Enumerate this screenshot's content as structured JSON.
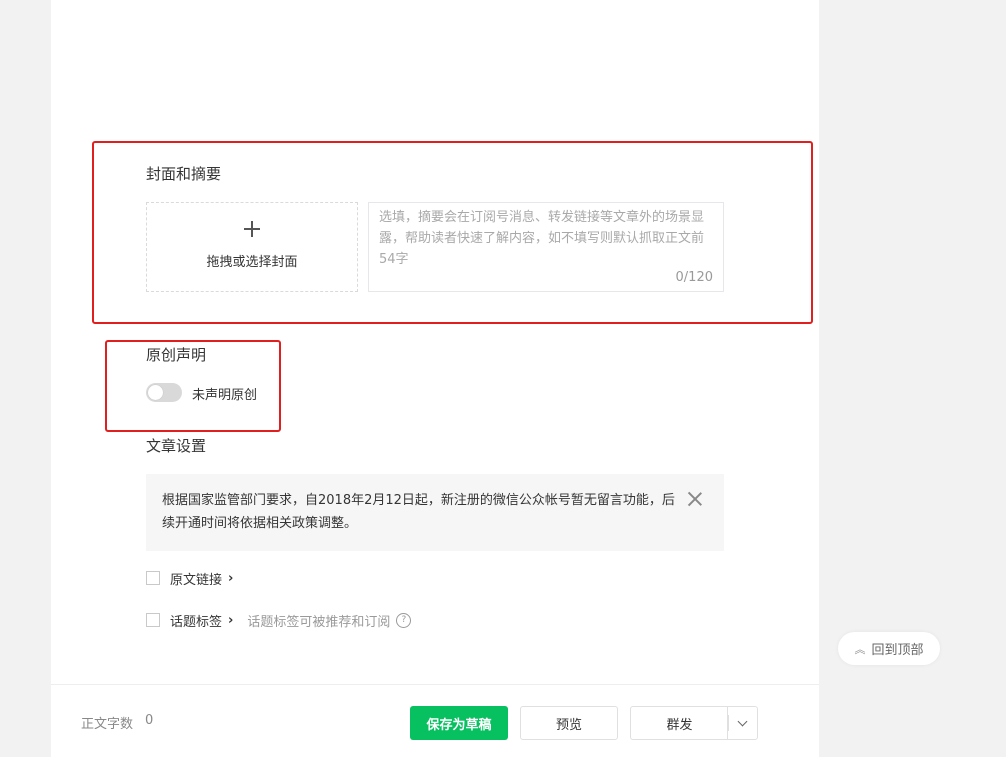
{
  "cover_summary": {
    "title": "封面和摘要",
    "cover_upload_label": "拖拽或选择封面",
    "summary_placeholder": "选填，摘要会在订阅号消息、转发链接等文章外的场景显露，帮助读者快速了解内容，如不填写则默认抓取正文前54字",
    "summary_counter": "0/120"
  },
  "original": {
    "title": "原创声明",
    "toggle_label": "未声明原创",
    "toggle_on": false
  },
  "article_settings": {
    "title": "文章设置",
    "notice": "根据国家监管部门要求，自2018年2月12日起，新注册的微信公众帐号暂无留言功能，后续开通时间将依据相关政策调整。",
    "source_link_label": "原文链接",
    "topic_tag_label": "话题标签",
    "topic_tag_hint": "话题标签可被推荐和订阅",
    "chevron": "›",
    "help_glyph": "?"
  },
  "back_to_top": {
    "icon": "double-chevron-up-icon",
    "glyph": "︽",
    "label": "回到顶部"
  },
  "footer": {
    "word_count_label": "正文字数",
    "word_count_value": "0",
    "save_draft_label": "保存为草稿",
    "preview_label": "预览",
    "mass_send_label": "群发"
  },
  "colors": {
    "primary_green": "#07c160",
    "highlight_red": "#e11f1f"
  }
}
